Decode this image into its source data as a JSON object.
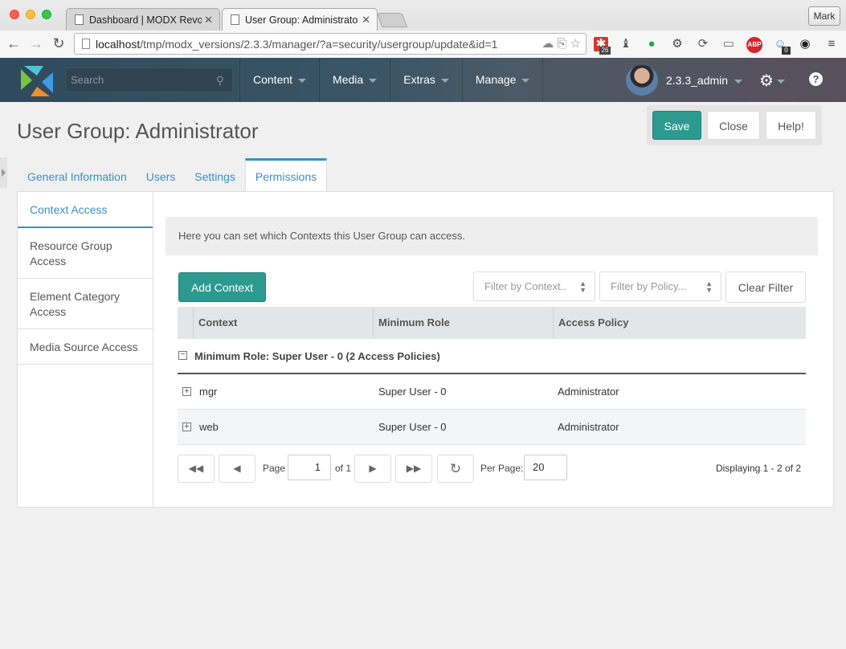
{
  "browser": {
    "tabs": [
      {
        "label": "Dashboard | MODX Revolu",
        "active": false
      },
      {
        "label": "User Group: Administrator",
        "active": true
      }
    ],
    "profile": "Mark",
    "url_host": "localhost",
    "url_path": "/tmp/modx_versions/2.3.3/manager/?a=security/usergroup/update&id=1",
    "ext_badge_1": "26",
    "ext_badge_2": "0",
    "abp": "ABP"
  },
  "header": {
    "search_placeholder": "Search",
    "nav": [
      "Content",
      "Media",
      "Extras",
      "Manage"
    ],
    "username": "2.3.3_admin"
  },
  "page": {
    "title": "User Group: Administrator",
    "actions": {
      "save": "Save",
      "close": "Close",
      "help": "Help!"
    },
    "tabs": [
      "General Information",
      "Users",
      "Settings",
      "Permissions"
    ],
    "active_tab": "Permissions"
  },
  "permissions": {
    "vtabs": [
      "Context Access",
      "Resource Group Access",
      "Element Category Access",
      "Media Source Access"
    ],
    "description": "Here you can set which Contexts this User Group can access.",
    "add_button": "Add Context",
    "filter_context_placeholder": "Filter by Context..",
    "filter_policy_placeholder": "Filter by Policy...",
    "clear_filter": "Clear Filter",
    "columns": [
      "Context",
      "Minimum Role",
      "Access Policy"
    ],
    "group_label": "Minimum Role: Super User - 0 (2 Access Policies)",
    "rows": [
      {
        "context": "mgr",
        "role": "Super User - 0",
        "policy": "Administrator"
      },
      {
        "context": "web",
        "role": "Super User - 0",
        "policy": "Administrator"
      }
    ],
    "pager": {
      "page_label": "Page",
      "page_value": "1",
      "of_label": "of 1",
      "per_page_label": "Per Page:",
      "per_page_value": "20",
      "display": "Displaying 1 - 2 of 2"
    }
  }
}
